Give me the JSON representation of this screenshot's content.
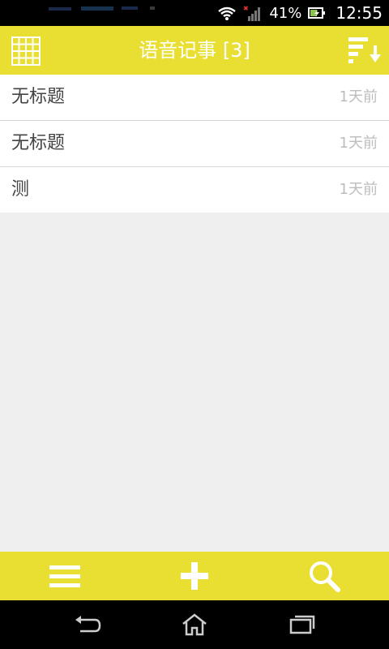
{
  "status_bar": {
    "battery": "41%",
    "time": "12:55",
    "icons": [
      "wifi-icon",
      "signal-icon",
      "battery-icon"
    ]
  },
  "app_bar": {
    "title": "语音记事 [3]",
    "left_icon": "grid-icon",
    "right_icon": "sort-icon"
  },
  "notes": [
    {
      "title": "无标题",
      "time": "1天前"
    },
    {
      "title": "无标题",
      "time": "1天前"
    },
    {
      "title": "测",
      "time": "1天前"
    }
  ],
  "bottom_bar": {
    "icons": [
      "menu-icon",
      "add-icon",
      "search-icon"
    ]
  },
  "nav_bar": {
    "icons": [
      "back-icon",
      "home-icon",
      "recent-apps-icon"
    ]
  },
  "colors": {
    "accent": "#e9df33",
    "background": "#efefef"
  }
}
